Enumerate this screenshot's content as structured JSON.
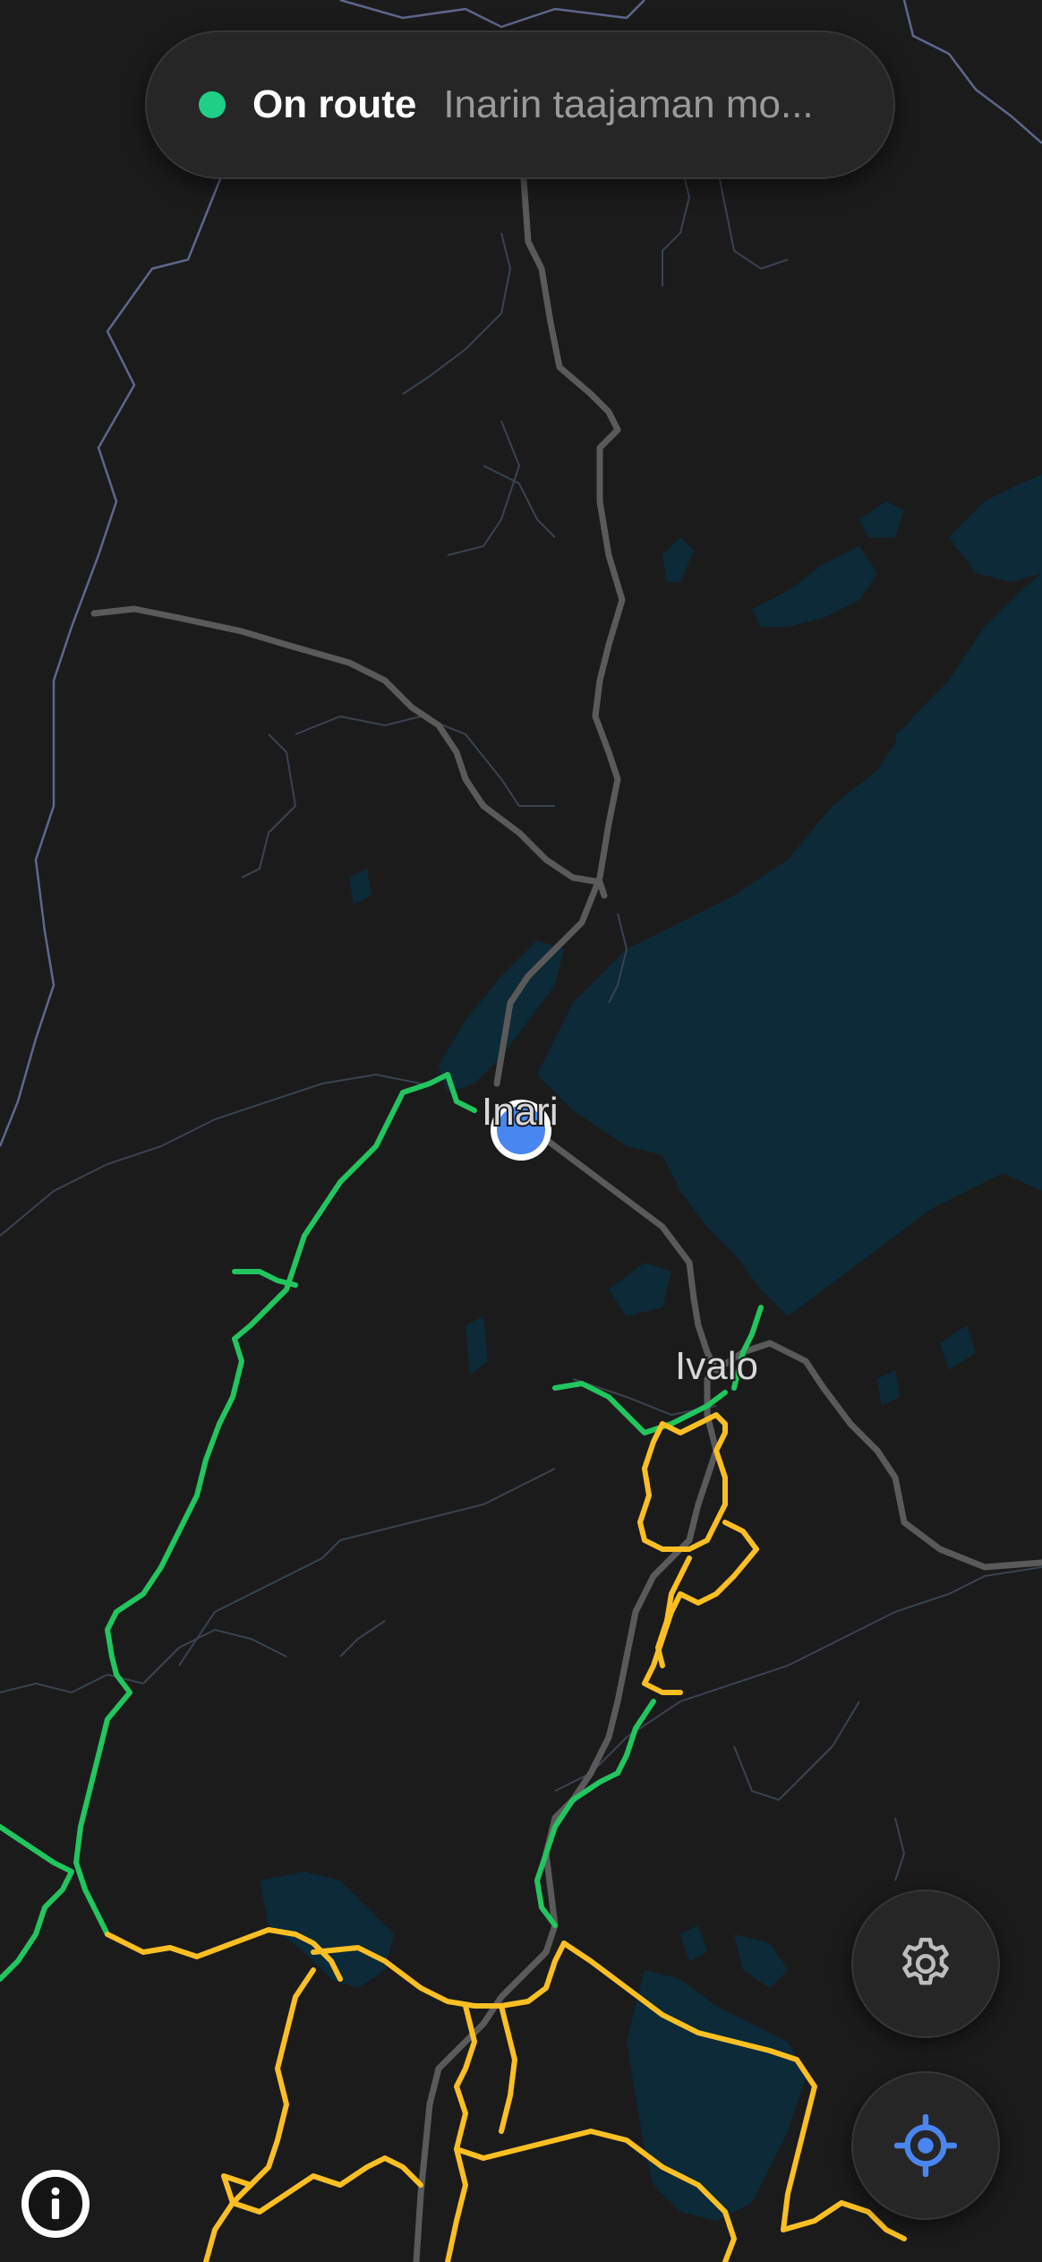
{
  "status": {
    "label": "On route",
    "destination": "Inarin taajaman mo...",
    "indicator_color": "#1fcf86"
  },
  "map": {
    "places": [
      {
        "name": "Inari"
      },
      {
        "name": "Ivalo"
      }
    ],
    "legend_colors": {
      "route_green": "#22c55e",
      "route_yellow": "#fbbf24",
      "road": "#5a5a5a",
      "water": "#0c2a38",
      "border": "#6f7aa8",
      "user_location": "#4a86f0"
    }
  },
  "controls": {
    "settings_icon": "gear-icon",
    "locate_icon": "crosshair-icon",
    "info_icon": "info-icon"
  }
}
